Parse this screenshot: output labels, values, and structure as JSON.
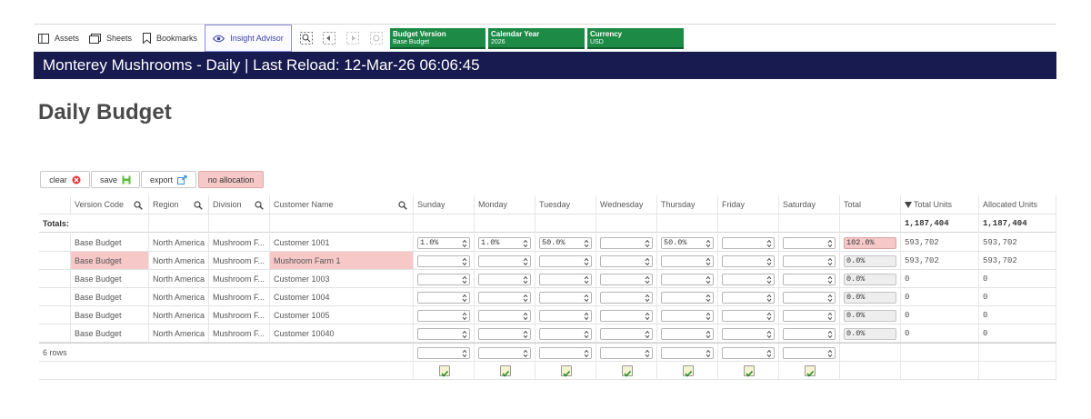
{
  "toolbar": {
    "assets_label": "Assets",
    "sheets_label": "Sheets",
    "bookmarks_label": "Bookmarks",
    "insight_label": "Insight Advisor"
  },
  "selections": [
    {
      "title": "Budget Version",
      "value": "Base Budget"
    },
    {
      "title": "Calendar Year",
      "value": "2026"
    },
    {
      "title": "Currency",
      "value": "USD"
    }
  ],
  "colors": {
    "title_bar": "#181b4f",
    "selection_green": "#1d8a46",
    "highlight_pink": "#f6c8c8"
  },
  "app_title": "Monterey Mushrooms - Daily | Last Reload: 12-Mar-26 06:06:45",
  "sheet_title": "Daily Budget",
  "buttons": {
    "clear": "clear",
    "save": "save",
    "export": "export",
    "no_allocation": "no allocation"
  },
  "table": {
    "headers": {
      "version_code": "Version Code",
      "region": "Region",
      "division": "Division",
      "customer_name": "Customer Name",
      "sunday": "Sunday",
      "monday": "Monday",
      "tuesday": "Tuesday",
      "wednesday": "Wednesday",
      "thursday": "Thursday",
      "friday": "Friday",
      "saturday": "Saturday",
      "total": "Total",
      "total_units": "Total Units",
      "allocated_units": "Allocated Units"
    },
    "totals_label": "Totals:",
    "totals": {
      "total_units": "1,187,404",
      "allocated_units": "1,187,404"
    },
    "rows": [
      {
        "version": "Base Budget",
        "region": "North America",
        "division": "Mushroom F...",
        "customer": "Customer 1001",
        "days": [
          "1.0%",
          "1.0%",
          "50.0%",
          "",
          "50.0%",
          "",
          ""
        ],
        "total": "102.0%",
        "total_units": "593,702",
        "allocated_units": "593,702"
      },
      {
        "version": "Base Budget",
        "region": "North America",
        "division": "Mushroom F...",
        "customer": "Mushroom Farm 1",
        "days": [
          "",
          "",
          "",
          "",
          "",
          "",
          ""
        ],
        "total": "0.0%",
        "total_units": "593,702",
        "allocated_units": "593,702"
      },
      {
        "version": "Base Budget",
        "region": "North America",
        "division": "Mushroom F...",
        "customer": "Customer 1003",
        "days": [
          "",
          "",
          "",
          "",
          "",
          "",
          ""
        ],
        "total": "0.0%",
        "total_units": "0",
        "allocated_units": "0"
      },
      {
        "version": "Base Budget",
        "region": "North America",
        "division": "Mushroom F...",
        "customer": "Customer 1004",
        "days": [
          "",
          "",
          "",
          "",
          "",
          "",
          ""
        ],
        "total": "0.0%",
        "total_units": "0",
        "allocated_units": "0"
      },
      {
        "version": "Base Budget",
        "region": "North America",
        "division": "Mushroom F...",
        "customer": "Customer 1005",
        "days": [
          "",
          "",
          "",
          "",
          "",
          "",
          ""
        ],
        "total": "0.0%",
        "total_units": "0",
        "allocated_units": "0"
      },
      {
        "version": "Base Budget",
        "region": "North America",
        "division": "Mushroom F...",
        "customer": "Customer 10040",
        "days": [
          "",
          "",
          "",
          "",
          "",
          "",
          ""
        ],
        "total": "0.0%",
        "total_units": "0",
        "allocated_units": "0"
      }
    ],
    "row_count": "6 rows"
  }
}
